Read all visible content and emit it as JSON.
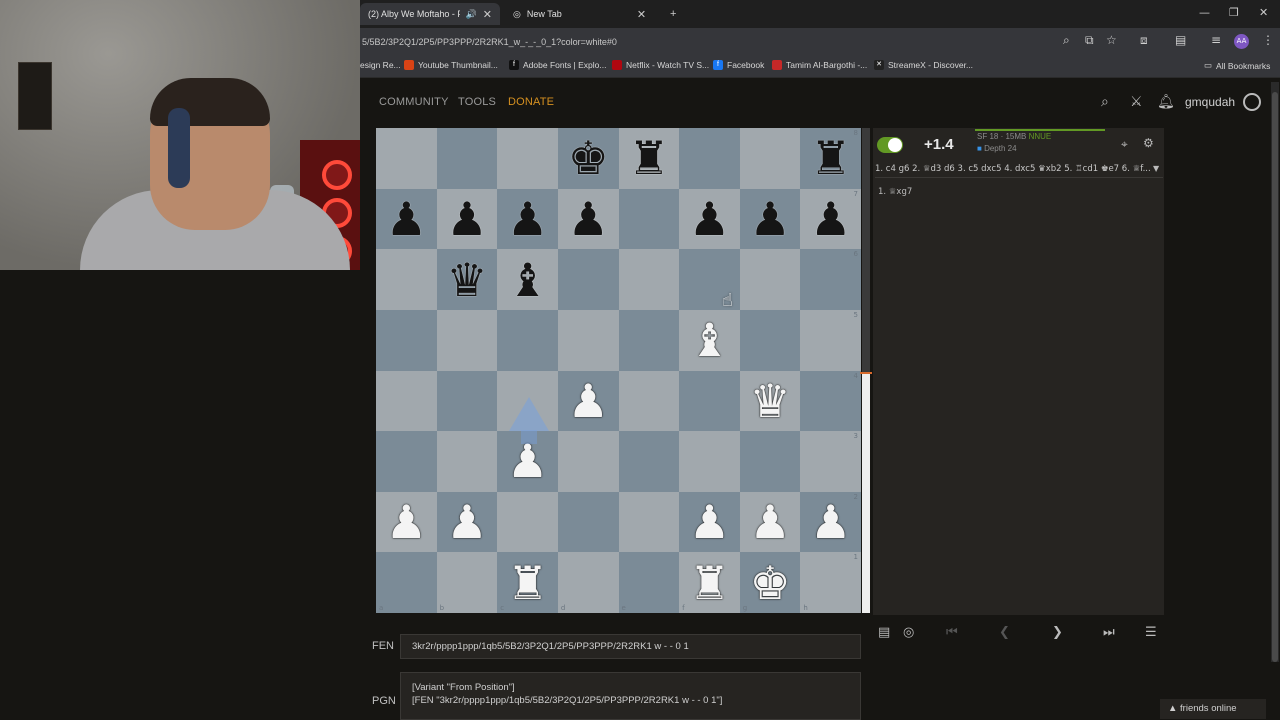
{
  "tabs": [
    {
      "label": "(2) Alby We Moftaho - Faric",
      "active": true
    },
    {
      "label": "New Tab",
      "active": false
    }
  ],
  "address": {
    "url": "5/5B2/3P2Q1/2P5/PP3PPP/2R2RK1_w_-_-_0_1?color=white#0"
  },
  "bookmarks": [
    {
      "label": "esign Re..."
    },
    {
      "label": "Youtube Thumbnail..."
    },
    {
      "label": "Adobe Fonts | Explo..."
    },
    {
      "label": "Netflix - Watch TV S..."
    },
    {
      "label": "Facebook"
    },
    {
      "label": "Tamim Al-Bargothi -..."
    },
    {
      "label": "StreameX - Discover..."
    }
  ],
  "all_bookmarks": "All Bookmarks",
  "profile_initials": "AA",
  "site_nav": {
    "community": "COMMUNITY",
    "tools": "TOOLS",
    "donate": "DONATE"
  },
  "username": "gmqudah",
  "board": {
    "ranks": [
      "8",
      "7",
      "6",
      "5",
      "4",
      "3",
      "2",
      "1"
    ],
    "files": [
      "a",
      "b",
      "c",
      "d",
      "e",
      "f",
      "g",
      "h"
    ],
    "position": [
      [
        "",
        "",
        "",
        "bK",
        "bR",
        "",
        "",
        "bR"
      ],
      [
        "bP",
        "bP",
        "bP",
        "bP",
        "",
        "bP",
        "bP",
        "bP"
      ],
      [
        "",
        "bQ",
        "bB",
        "",
        "",
        "",
        "",
        ""
      ],
      [
        "",
        "",
        "",
        "",
        "",
        "wB",
        "",
        ""
      ],
      [
        "",
        "",
        "",
        "wP",
        "",
        "",
        "wQ",
        ""
      ],
      [
        "",
        "",
        "wP",
        "",
        "",
        "",
        "",
        ""
      ],
      [
        "wP",
        "wP",
        "",
        "",
        "",
        "wP",
        "wP",
        "wP"
      ],
      [
        "",
        "",
        "wR",
        "",
        "",
        "wR",
        "wK",
        ""
      ]
    ],
    "eval_white_fraction": 0.495
  },
  "ceval": {
    "score": "+1.4",
    "engine": "SF 18 · 15MB",
    "nnue": "NNUE",
    "depth": "Depth 24",
    "pv": "1. c4 g6 2. ♕d3 d6 3. c5 dxc5 4. dxc5 ♛xb2 5. ♖cd1 ♚e7 6. ♕f...",
    "moves": "1. ♕xg7"
  },
  "fen": {
    "label": "FEN",
    "value": "3kr2r/pppp1ppp/1qb5/5B2/3P2Q1/2P5/PP3PPP/2R2RK1 w - - 0 1"
  },
  "pgn": {
    "label": "PGN",
    "line1": "[Variant \"From Position\"]",
    "line2": "[FEN \"3kr2r/pppp1ppp/1qb5/5B2/3P2Q1/2P5/PP3PPP/2R2RK1 w - - 0 1\"]"
  },
  "friends": "friends online",
  "colors": {
    "light_square": "#a1a8ad",
    "dark_square": "#7b8b97",
    "accent_green": "#629924",
    "donate": "#d59020"
  }
}
